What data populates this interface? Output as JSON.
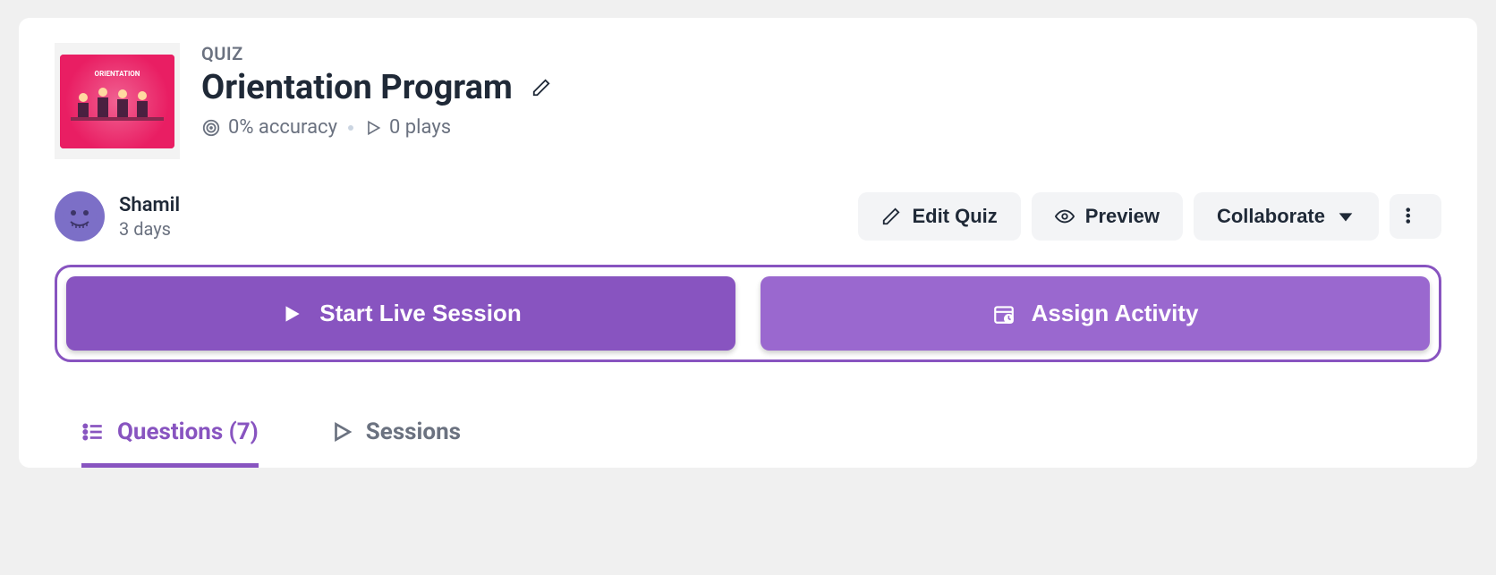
{
  "type_label": "QUIZ",
  "title": "Orientation Program",
  "accuracy_text": "0% accuracy",
  "plays_text": "0 plays",
  "author": {
    "name": "Shamil",
    "time": "3 days"
  },
  "buttons": {
    "edit": "Edit Quiz",
    "preview": "Preview",
    "collaborate": "Collaborate"
  },
  "cta": {
    "start_live": "Start Live Session",
    "assign": "Assign Activity"
  },
  "tabs": {
    "questions": "Questions (7)",
    "sessions": "Sessions"
  }
}
